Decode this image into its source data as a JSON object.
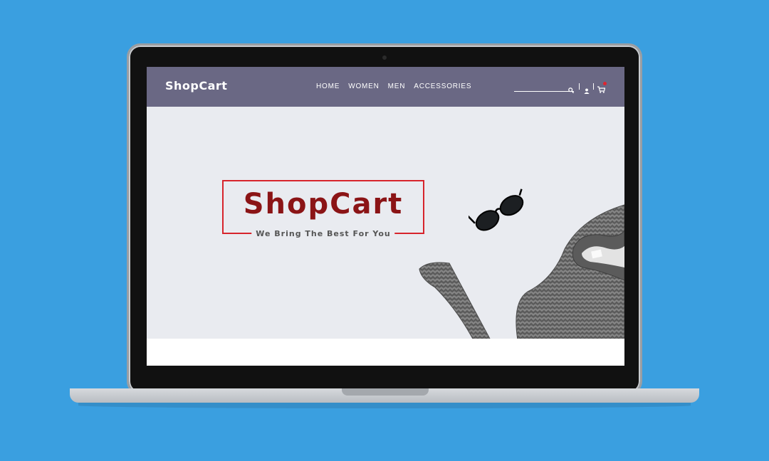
{
  "site": {
    "logo": "ShopCart",
    "nav": [
      "HOME",
      "WOMEN",
      "MEN",
      "ACCESSORIES"
    ],
    "search_placeholder": "",
    "icons": [
      "search-icon",
      "user-icon",
      "cart-icon"
    ],
    "accent_color": "#d7242c",
    "header_color": "#6a6884"
  },
  "hero": {
    "brand_title": "ShopCart",
    "tagline": "We Bring The Best For You",
    "title_color": "#8b1416"
  },
  "background": {
    "color": "#3a9fe0"
  }
}
